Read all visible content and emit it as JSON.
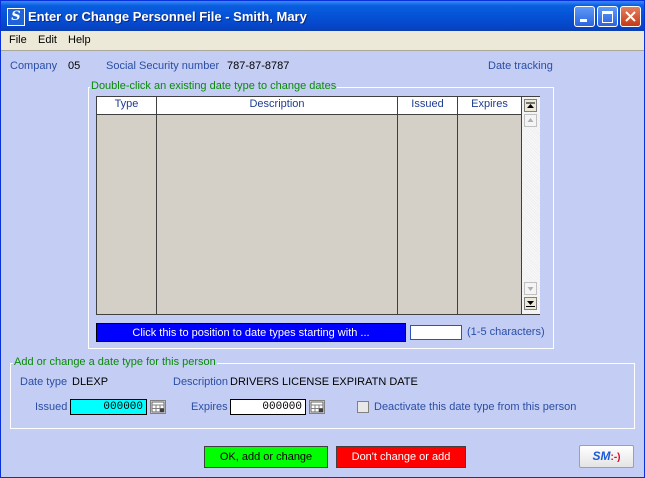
{
  "window": {
    "title": "Enter or Change Personnel File - Smith, Mary",
    "icon_letter": "S"
  },
  "menu": [
    "File",
    "Edit",
    "Help"
  ],
  "header": {
    "company_label": "Company",
    "company_value": "05",
    "ssn_label": "Social Security number",
    "ssn_value": "787-87-8787",
    "date_tracking_label": "Date tracking"
  },
  "grid": {
    "group_label": "Double-click an existing date type to change dates",
    "columns": [
      "Type",
      "Description",
      "Issued",
      "Expires"
    ],
    "rows": []
  },
  "position_bar": {
    "label": "Click this to position to date types starting with ...",
    "input_value": "",
    "hint": "(1-5 characters)"
  },
  "edit": {
    "group_label": "Add or change a date type for this person",
    "date_type_label": "Date type",
    "date_type_value": "DLEXP",
    "description_label": "Description",
    "description_value": "DRIVERS LICENSE EXPIRATN DATE",
    "issued_label": "Issued",
    "issued_value": "000000",
    "expires_label": "Expires",
    "expires_value": "000000",
    "deactivate_label": "Deactivate this date type from this person",
    "deactivate_checked": false
  },
  "buttons": {
    "ok": "OK, add or change",
    "cancel": "Don't change or add",
    "sm_logo": "SM",
    "sm_smile": ":-)"
  },
  "colors": {
    "ok_bg": "#00ff00",
    "cancel_bg": "#ff0000",
    "position_bar_bg": "#0000ff",
    "issued_field_bg": "#00ffff",
    "window_bg": "#c4cdf3"
  }
}
